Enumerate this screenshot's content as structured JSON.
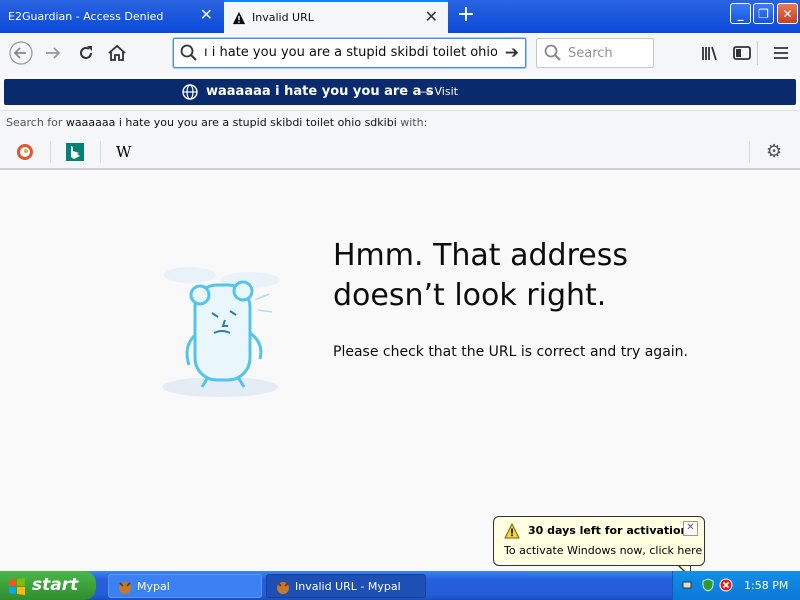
{
  "tabs": [
    {
      "label": "E2Guardian - Access Denied",
      "active": false
    },
    {
      "label": "Invalid URL",
      "active": true
    }
  ],
  "window_controls": {
    "minimize": "_",
    "maximize": "❐",
    "close": "✕"
  },
  "toolbar": {
    "url_value": "ı i hate you you are a stupid skibdi toilet ohio sdkibi",
    "search_placeholder": "Search"
  },
  "dropdown": {
    "suggestion_text": "waaaaaa i hate you you are a s",
    "suggestion_action": "— Visit",
    "search_for_prefix": "Search for ",
    "search_for_query": "waaaaaa i hate you you are a stupid skibdi toilet ohio sdkibi",
    "search_for_suffix": " with:",
    "engines": [
      "duckduckgo-icon",
      "bing-icon",
      "wikipedia-icon"
    ],
    "wikipedia_glyph": "W"
  },
  "error_page": {
    "title_line1": "Hmm. That address",
    "title_line2": "doesn’t look right.",
    "description": "Please check that the URL is correct and try again."
  },
  "balloon": {
    "title": "30 days left for activation",
    "text": "To activate Windows now, click here",
    "close": "✕"
  },
  "taskbar": {
    "start_label": "start",
    "tasks": [
      {
        "label": "Mypal",
        "active": false
      },
      {
        "label": "Invalid URL - Mypal",
        "active": true
      }
    ],
    "clock": "1:58 PM"
  },
  "colors": {
    "accent": "#0a84ff",
    "titlebar_blue": "#0a4ad8",
    "suggest_bg": "#0a2a6e",
    "taskbar_blue": "#245edb",
    "start_green": "#2d8e2d"
  }
}
